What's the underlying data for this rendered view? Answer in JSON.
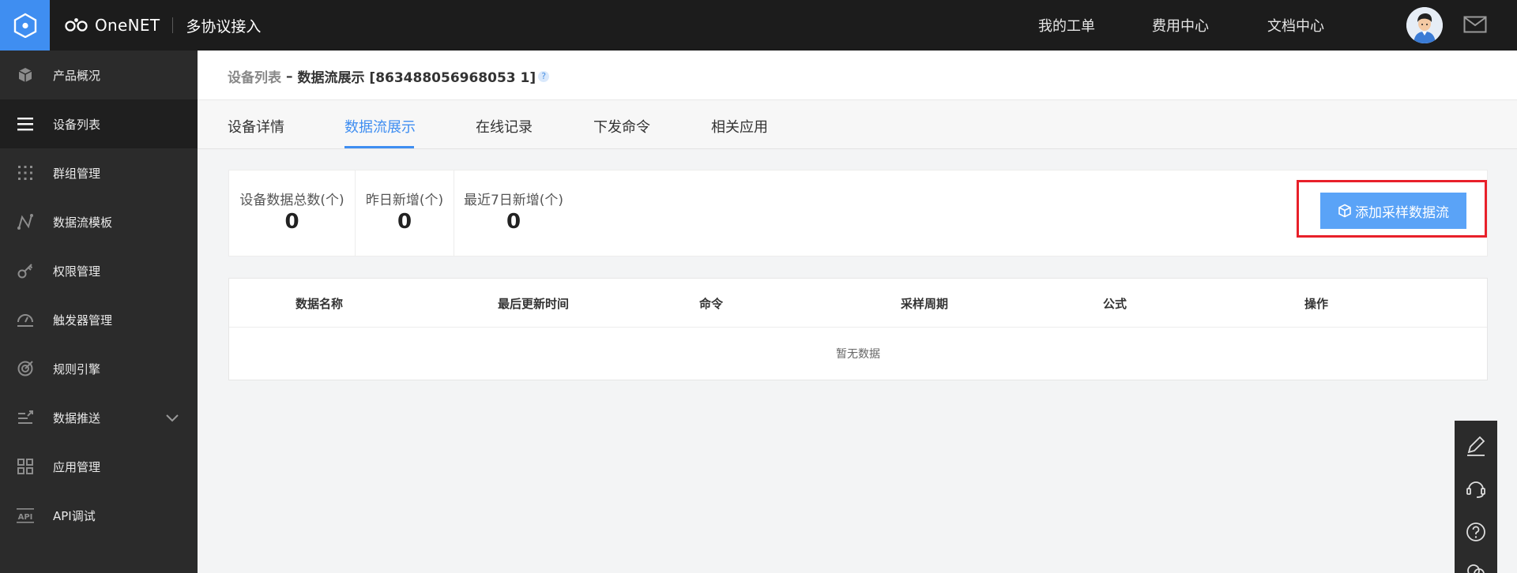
{
  "brand": {
    "name": "OneNET",
    "product": "多协议接入"
  },
  "header": {
    "links": [
      "我的工单",
      "费用中心",
      "文档中心"
    ]
  },
  "sidebar": {
    "items": [
      {
        "label": "产品概况",
        "icon": "cube-icon"
      },
      {
        "label": "设备列表",
        "icon": "list-icon"
      },
      {
        "label": "群组管理",
        "icon": "grid-dots-icon"
      },
      {
        "label": "数据流模板",
        "icon": "flow-icon"
      },
      {
        "label": "权限管理",
        "icon": "key-icon"
      },
      {
        "label": "触发器管理",
        "icon": "trigger-icon"
      },
      {
        "label": "规则引擎",
        "icon": "target-icon"
      },
      {
        "label": "数据推送",
        "icon": "push-icon"
      },
      {
        "label": "应用管理",
        "icon": "apps-icon"
      },
      {
        "label": "API调试",
        "icon": "api-icon"
      }
    ],
    "active": "设备列表"
  },
  "breadcrumb": {
    "parent": "设备列表",
    "separator": "–",
    "current": "数据流展示 [863488056968053 1]",
    "help": "?"
  },
  "tabs": [
    "设备详情",
    "数据流展示",
    "在线记录",
    "下发命令",
    "相关应用"
  ],
  "active_tab": "数据流展示",
  "stats": [
    {
      "label": "设备数据总数(个)",
      "value": "0"
    },
    {
      "label": "昨日新增(个)",
      "value": "0"
    },
    {
      "label": "最近7日新增(个)",
      "value": "0"
    }
  ],
  "actions": {
    "add_stream": "添加采样数据流"
  },
  "table": {
    "columns": [
      "数据名称",
      "最后更新时间",
      "命令",
      "采样周期",
      "公式",
      "操作"
    ],
    "empty_text": "暂无数据"
  },
  "colors": {
    "accent": "#3f8ef1",
    "button": "#5aa3f7",
    "highlight": "#e8202a",
    "sidebar": "#2b2b2b",
    "topbar": "#1c1c1c"
  }
}
